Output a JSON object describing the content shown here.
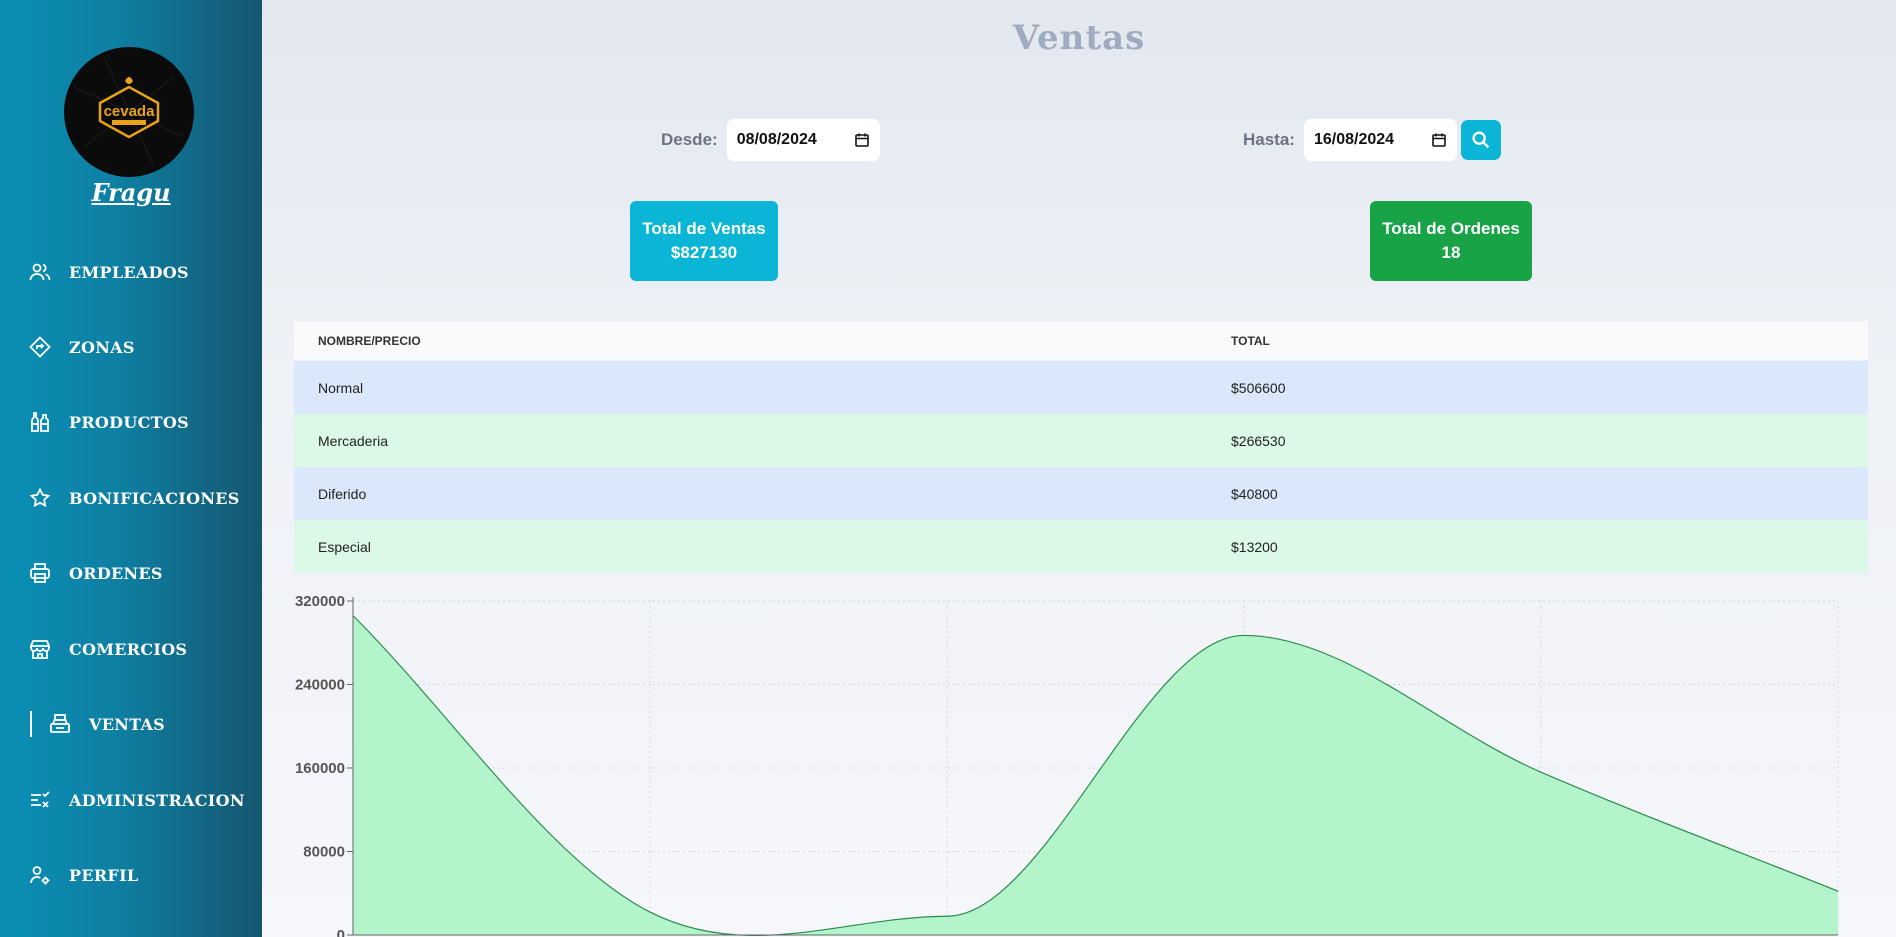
{
  "sidebar": {
    "brand": "Fragu",
    "logo_text": "cevada",
    "items": [
      {
        "label": "EMPLEADOS",
        "icon": "users-icon"
      },
      {
        "label": "ZONAS",
        "icon": "directions-icon"
      },
      {
        "label": "PRODUCTOS",
        "icon": "bottles-icon"
      },
      {
        "label": "BONIFICACIONES",
        "icon": "star-icon"
      },
      {
        "label": "ORDENES",
        "icon": "printer-icon"
      },
      {
        "label": "COMERCIOS",
        "icon": "store-icon"
      },
      {
        "label": "VENTAS",
        "icon": "cash-register-icon",
        "active": true
      },
      {
        "label": "ADMINISTRACION",
        "icon": "checklist-icon"
      },
      {
        "label": "PERFIL",
        "icon": "user-gear-icon"
      }
    ]
  },
  "page": {
    "title": "Ventas"
  },
  "filters": {
    "desde_label": "Desde:",
    "desde_value": "08/08/2024",
    "hasta_label": "Hasta:",
    "hasta_value": "16/08/2024"
  },
  "stats": {
    "ventas_label": "Total de Ventas",
    "ventas_value": "$827130",
    "ordenes_label": "Total de Ordenes",
    "ordenes_value": "18"
  },
  "table": {
    "headers": [
      "NOMBRE/PRECIO",
      "TOTAL"
    ],
    "rows": [
      {
        "name": "Normal",
        "total": "$506600"
      },
      {
        "name": "Mercaderia",
        "total": "$266530"
      },
      {
        "name": "Diferido",
        "total": "$40800"
      },
      {
        "name": "Especial",
        "total": "$13200"
      }
    ]
  },
  "colors": {
    "accent": "#0bb5d6",
    "green": "#18a347",
    "chart_fill": "#b3f4cb",
    "chart_line": "#2e8b4e"
  },
  "chart_data": {
    "type": "area",
    "x": [
      0,
      1,
      2,
      3,
      4,
      5
    ],
    "values": [
      306000,
      22000,
      18000,
      287000,
      156000,
      42000
    ],
    "ylim": [
      0,
      320000
    ],
    "yticks": [
      "0",
      "80000",
      "160000",
      "240000",
      "320000"
    ],
    "grid": true
  }
}
